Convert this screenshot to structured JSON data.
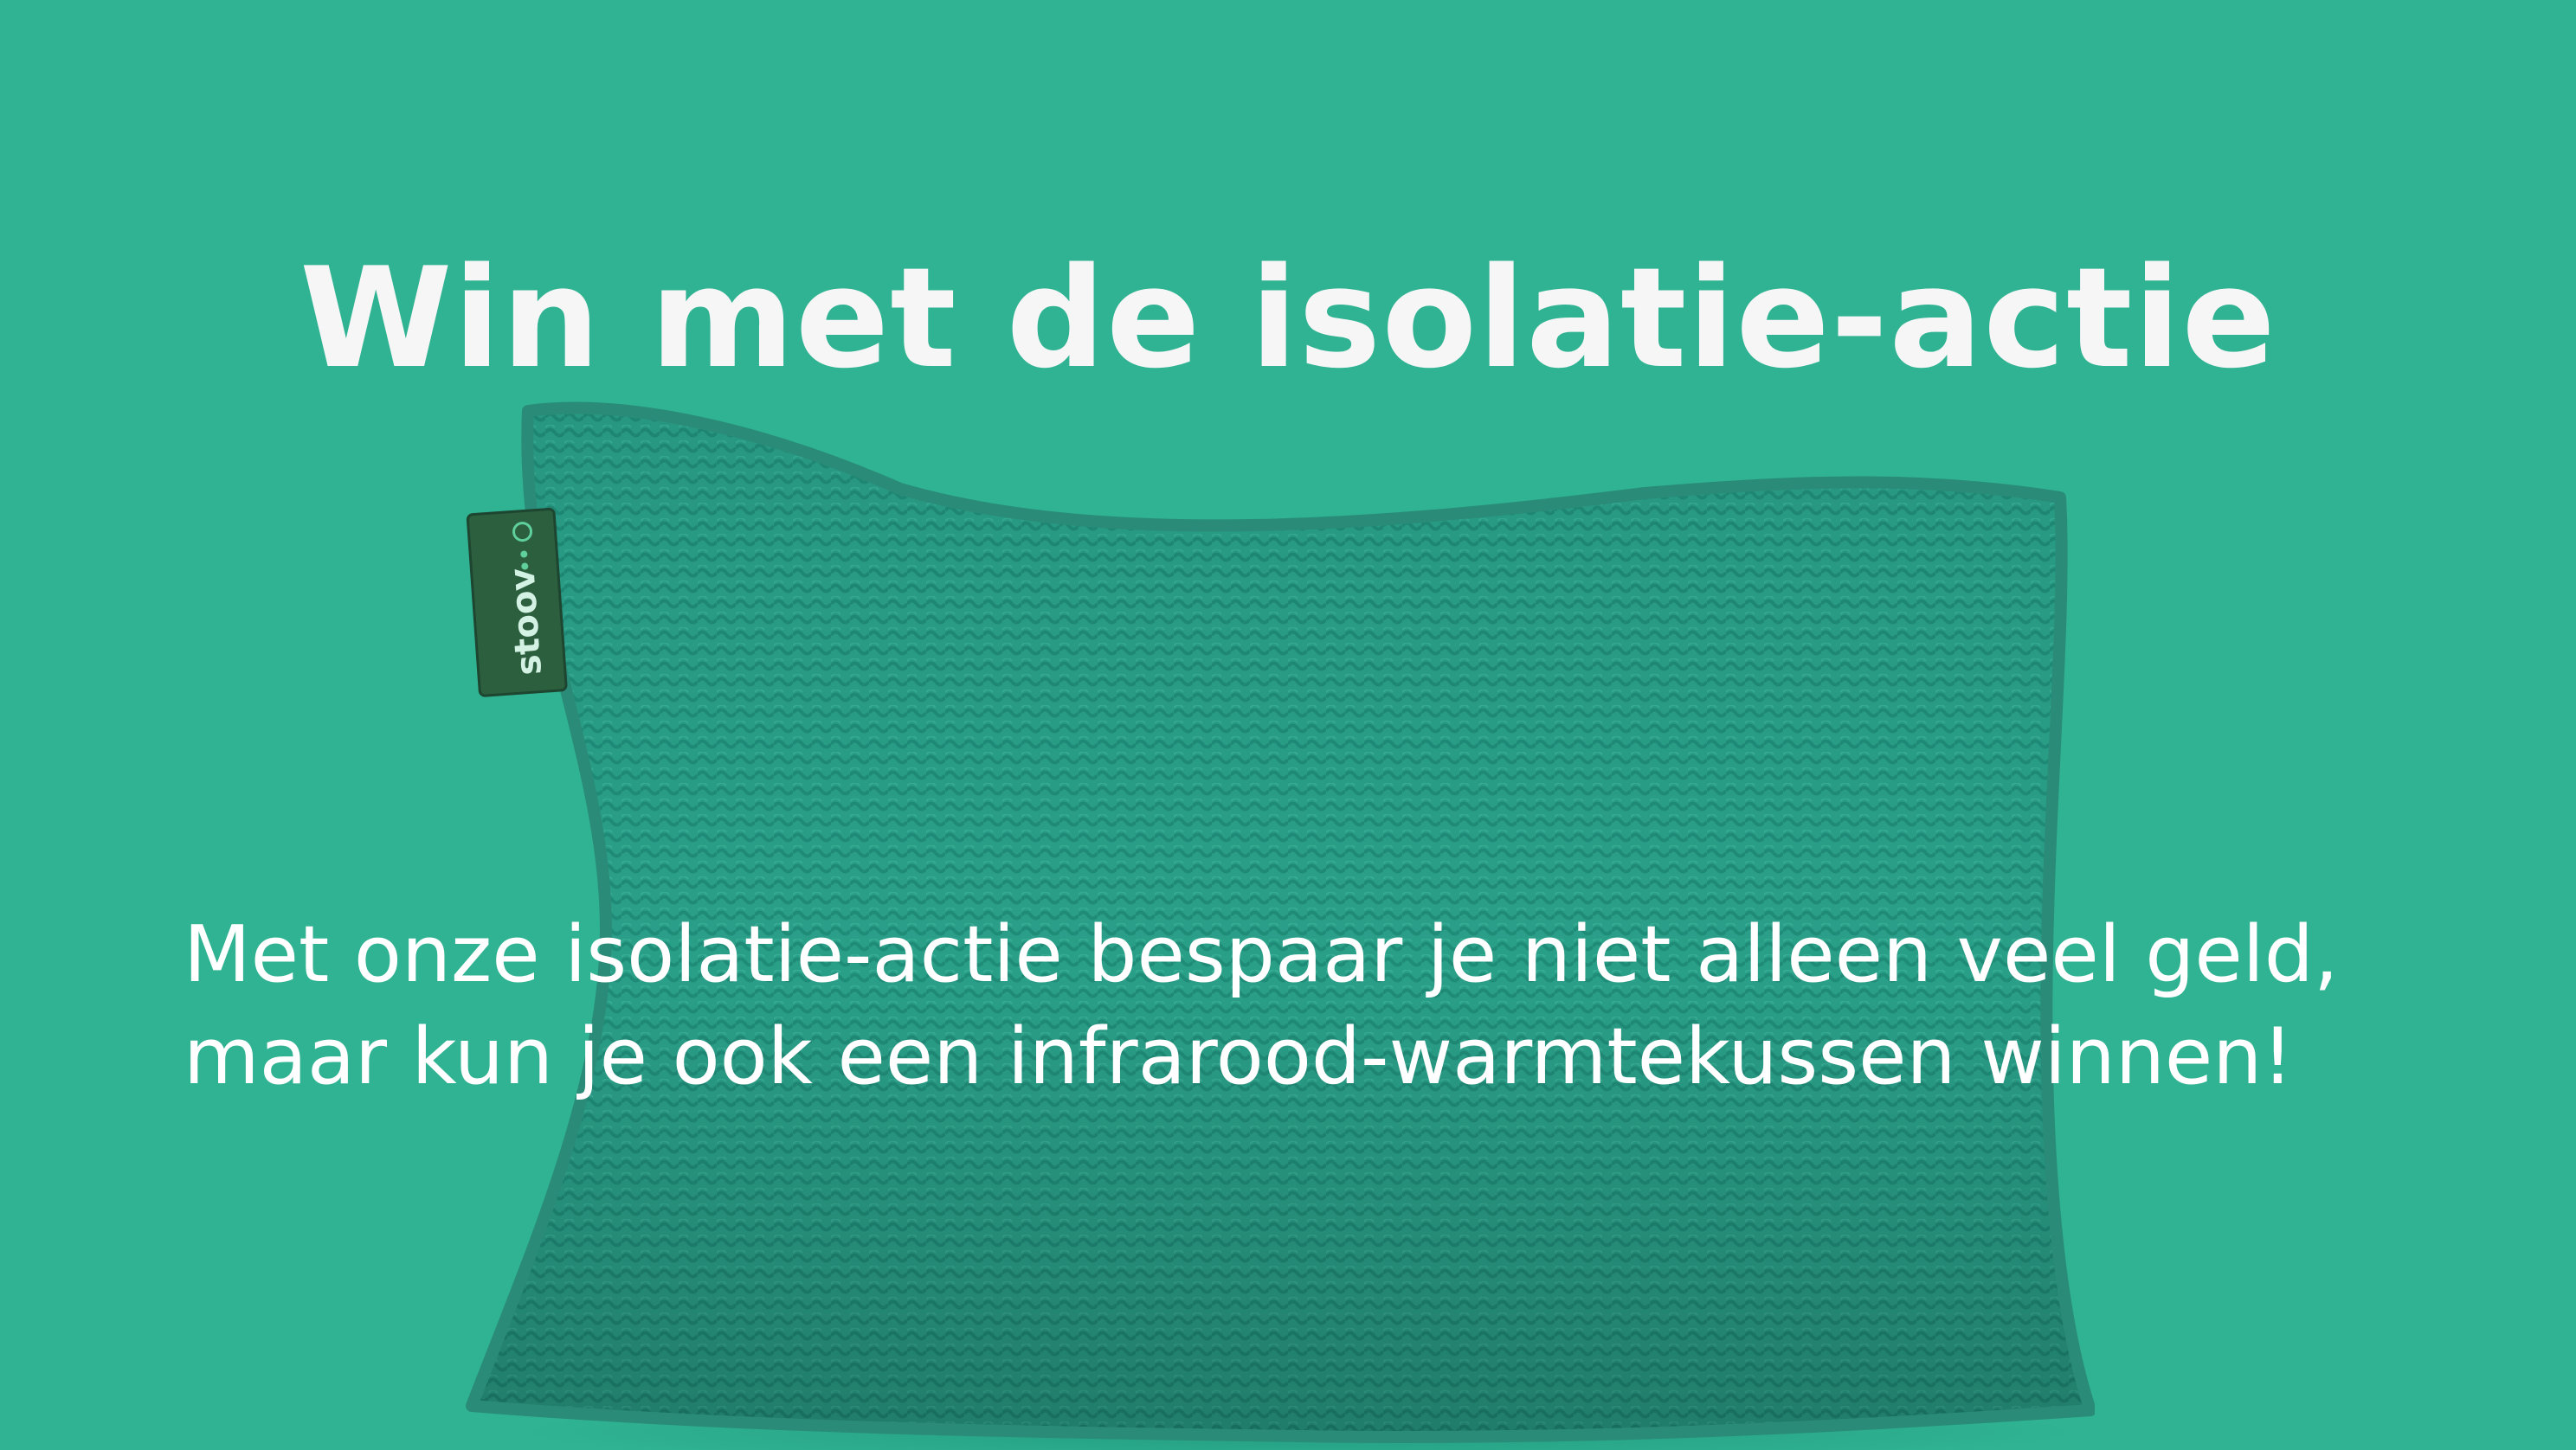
{
  "page": {
    "background_color": "#2fb392",
    "text_color": "#ffffff"
  },
  "headline": "Win met de isolatie-actie",
  "body": {
    "line1": "Met onze isolatie-actie bespaar je niet alleen veel geld,",
    "line2": "maar kun je ook een infrarood-warmtekussen winnen!"
  },
  "product_image": {
    "subject": "knitted infrared heating cushion",
    "tag_text": "stoov",
    "cushion_color": "#269f88",
    "tag_color": "#2c5f3e"
  }
}
